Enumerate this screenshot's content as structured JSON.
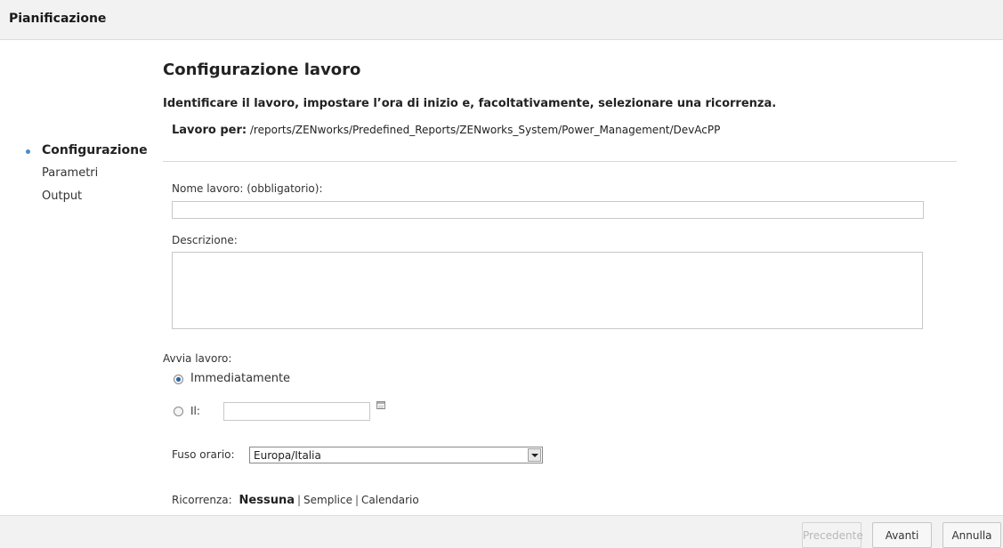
{
  "window": {
    "title": "Pianificazione"
  },
  "nav": {
    "items": [
      {
        "label": "Configurazione",
        "active": true
      },
      {
        "label": "Parametri",
        "active": false
      },
      {
        "label": "Output",
        "active": false
      }
    ]
  },
  "main": {
    "heading": "Configurazione lavoro",
    "instructions": "Identificare il lavoro, impostare l’ora di inizio e, facoltativamente, selezionare una ricorrenza.",
    "job_for_label": "Lavoro per:",
    "job_for_path": "/reports/ZENworks/Predefined_Reports/ZENworks_System/Power_Management/DevAcPP"
  },
  "form": {
    "job_name_label": "Nome lavoro: (obbligatorio):",
    "job_name_value": "",
    "description_label": "Descrizione:",
    "description_value": "",
    "start_label": "Avvia lavoro:",
    "start_options": [
      {
        "label": "Immediatamente",
        "selected": true
      },
      {
        "label": "Il:",
        "selected": false
      }
    ],
    "start_date_value": "",
    "timezone_label": "Fuso orario:",
    "timezone_value": "Europa/Italia",
    "recurrence_label": "Ricorrenza:",
    "recurrence_options": [
      {
        "label": "Nessuna",
        "selected": true
      },
      {
        "label": "Semplice",
        "selected": false
      },
      {
        "label": "Calendario",
        "selected": false
      }
    ]
  },
  "footer": {
    "previous_label": "Precedente",
    "next_label": "Avanti",
    "cancel_label": "Annulla"
  },
  "colors": {
    "accent": "#4a8bc2",
    "header_bg": "#f2f2f2"
  },
  "icons": {
    "calendar": "calendar-icon",
    "dropdown": "chevron-down-icon"
  }
}
